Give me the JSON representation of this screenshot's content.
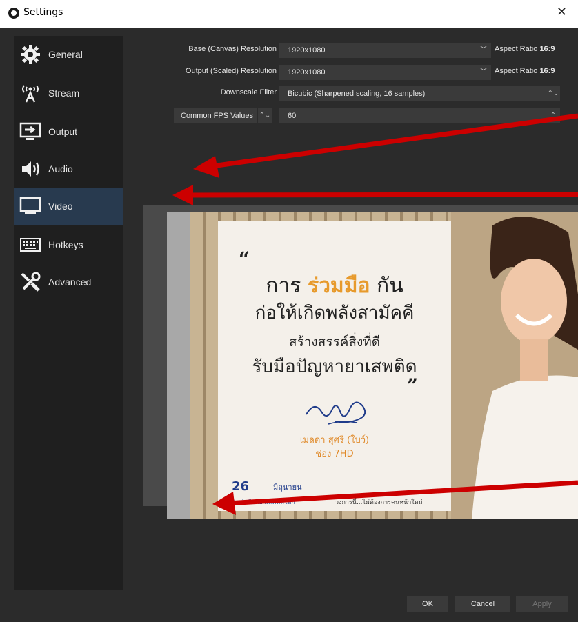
{
  "window": {
    "title": "Settings",
    "close_glyph": "✕"
  },
  "sidebar": {
    "items": [
      {
        "label": "General",
        "icon": "gear-icon"
      },
      {
        "label": "Stream",
        "icon": "antenna-icon",
        "icon_glyph": "((•))\nA"
      },
      {
        "label": "Output",
        "icon": "output-icon"
      },
      {
        "label": "Audio",
        "icon": "speaker-icon"
      },
      {
        "label": "Video",
        "icon": "monitor-icon",
        "active": true
      },
      {
        "label": "Hotkeys",
        "icon": "keyboard-icon"
      },
      {
        "label": "Advanced",
        "icon": "wrench-icon"
      }
    ]
  },
  "video": {
    "base_resolution_label": "Base (Canvas) Resolution",
    "base_resolution_value": "1920x1080",
    "base_aspect_label": "Aspect Ratio",
    "base_aspect_value": "16:9",
    "output_resolution_label": "Output (Scaled) Resolution",
    "output_resolution_value": "1920x1080",
    "output_aspect_label": "Aspect Ratio",
    "output_aspect_value": "16:9",
    "downscale_label": "Downscale Filter",
    "downscale_value": "Bicubic (Sharpened scaling, 16 samples)",
    "fps_type_label": "Common FPS Values",
    "fps_value": "60"
  },
  "preview": {
    "quote_open": "“",
    "quote_close": "”",
    "line1_a": "การ",
    "line1_highlight": "ร่วมมือ",
    "line1_b": "กัน",
    "line2": "ก่อให้เกิดพลังสามัคคี",
    "line3": "สร้างสรรค์สิ่งที่ดี",
    "line4": "รับมือปัญหายาเสพติด",
    "person_name": "เมลดา สุศรี (ใบว์)",
    "person_channel": "ช่อง 7HD",
    "footer_date": "26",
    "footer_month": "มิถุนายน",
    "footer_sub1": "วันต่อต้านยาเสพติดโลก",
    "footer_sub2": "วงการนี้...ไม่ต้องการคนหน้าใหม่"
  },
  "buttons": {
    "ok": "OK",
    "cancel": "Cancel",
    "apply": "Apply"
  },
  "colors": {
    "background": "#2b2b2b",
    "sidebar": "#1f1f1f",
    "active_item": "#283a4f",
    "field": "#3a3a3a",
    "arrow": "#cc0000",
    "highlight_text": "#e79a2c"
  }
}
